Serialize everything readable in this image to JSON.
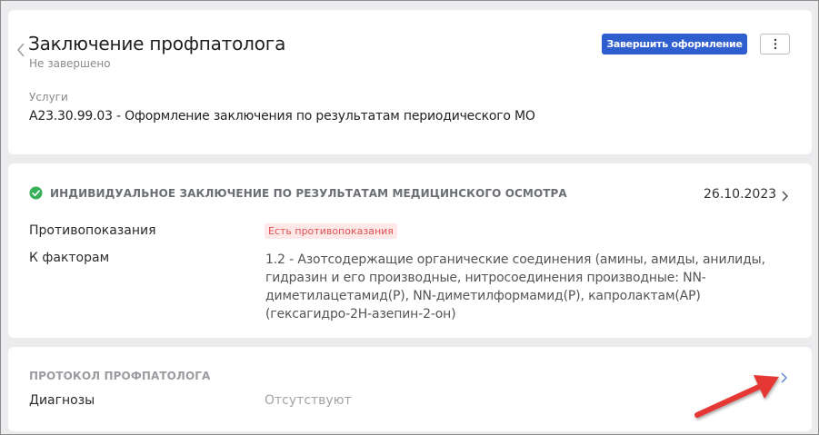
{
  "header": {
    "title": "Заключение профпатолога",
    "status": "Не завершено",
    "finish_button": "Завершить оформление",
    "more_button": "⋮"
  },
  "services": {
    "label": "Услуги",
    "value": "A23.30.99.03 - Оформление заключения по результатам периодического МО"
  },
  "conclusion": {
    "title": "ИНДИВИДУАЛЬНОЕ ЗАКЛЮЧЕНИЕ ПО РЕЗУЛЬТАТАМ МЕДИЦИНСКОГО ОСМОТРА",
    "date": "26.10.2023",
    "contraindications_label": "Противопоказания",
    "contraindications_value": "Есть противопоказания",
    "factors_label": "К факторам",
    "factors_value": "1.2 - Азотсодержащие органические соединения (амины, амиды, анилиды, гидразин и его производные, нитросоединения производные: NN-диметилацетамид(Р), NN-диметилформамид(Р), капролактам(АР) (гексагидро-2Н-азепин-2-он)"
  },
  "protocol": {
    "title": "ПРОТОКОЛ ПРОФПАТОЛОГА",
    "diagnoses_label": "Диагнозы",
    "diagnoses_value": "Отсутствуют"
  },
  "colors": {
    "primary": "#2f5fce",
    "success": "#3ab05a",
    "danger_text": "#e05252",
    "danger_bg": "#fde8e8",
    "annotation_arrow": "#e53935"
  }
}
